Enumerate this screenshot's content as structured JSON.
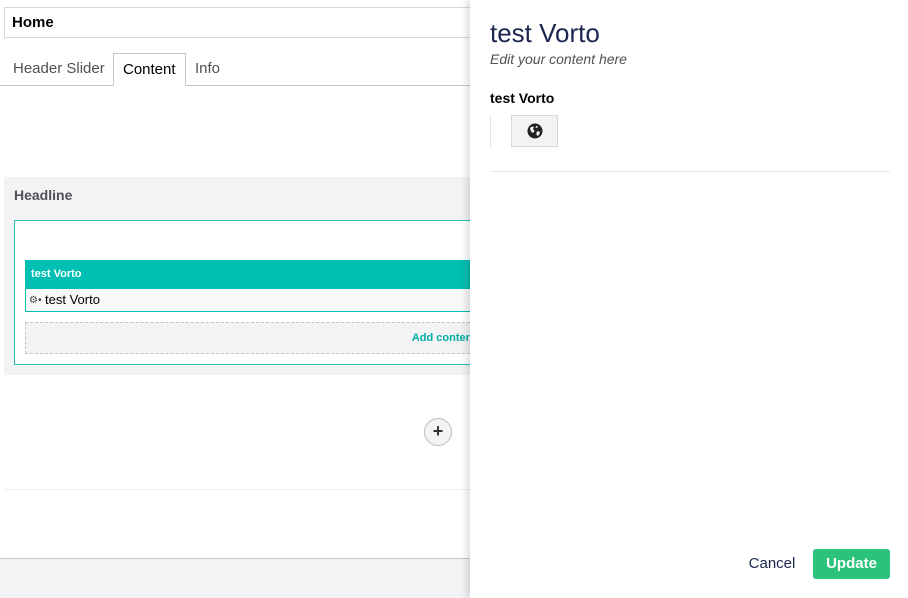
{
  "editor": {
    "name_value": "Home",
    "tabs": [
      {
        "label": "Header Slider",
        "active": false
      },
      {
        "label": "Content",
        "active": true
      },
      {
        "label": "Info",
        "active": false
      }
    ],
    "grid": {
      "section_title": "Headline",
      "control": {
        "header": "test Vorto",
        "body_label": "test Vorto",
        "body_icon": "gears-icon"
      },
      "add_content_label": "Add content"
    },
    "add_row_symbol": "+"
  },
  "panel": {
    "title": "test Vorto",
    "subtitle": "Edit your content here",
    "property_label": "test Vorto",
    "language_icon": "globe-icon",
    "buttons": {
      "cancel": "Cancel",
      "update": "Update"
    }
  },
  "colors": {
    "accent": "#00bfb3",
    "update": "#2bc37c",
    "text": "#1b264f"
  }
}
